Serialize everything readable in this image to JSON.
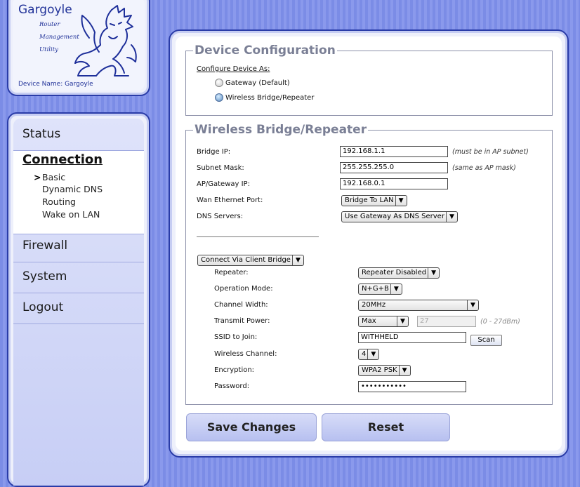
{
  "logo": {
    "title": "Gargoyle",
    "lines": [
      "Router",
      "Management",
      "Utility"
    ],
    "device_name": "Device Name: Gargoyle"
  },
  "nav": {
    "status": "Status",
    "connection": "Connection",
    "sub_arrow": ">",
    "sub_items": [
      "Basic",
      "Dynamic DNS",
      "Routing",
      "Wake on LAN"
    ],
    "firewall": "Firewall",
    "system": "System",
    "logout": "Logout"
  },
  "device_config": {
    "legend": "Device Configuration",
    "configure_label": "Configure Device As:",
    "options": [
      {
        "label": "Gateway (Default)",
        "selected": false
      },
      {
        "label": "Wireless Bridge/Repeater",
        "selected": true
      }
    ]
  },
  "bridge": {
    "legend": "Wireless Bridge/Repeater",
    "bridge_ip": {
      "label": "Bridge IP:",
      "value": "192.168.1.1",
      "note": "(must be in AP subnet)"
    },
    "subnet_mask": {
      "label": "Subnet Mask:",
      "value": "255.255.255.0",
      "note": "(same as AP mask)"
    },
    "gateway_ip": {
      "label": "AP/Gateway IP:",
      "value": "192.168.0.1"
    },
    "wan_port": {
      "label": "Wan Ethernet Port:",
      "value": "Bridge To LAN"
    },
    "dns": {
      "label": "DNS Servers:",
      "value": "Use Gateway As DNS Server"
    },
    "connect_mode": "Connect Via Client Bridge",
    "repeater": {
      "label": "Repeater:",
      "value": "Repeater Disabled"
    },
    "op_mode": {
      "label": "Operation Mode:",
      "value": "N+G+B"
    },
    "channel_width": {
      "label": "Channel Width:",
      "value": "20MHz"
    },
    "tx_power": {
      "label": "Transmit Power:",
      "value": "Max",
      "dbm": "27",
      "note": "(0 - 27dBm)"
    },
    "ssid": {
      "label": "SSID to Join:",
      "value": "WITHHELD",
      "scan": "Scan"
    },
    "channel": {
      "label": "Wireless Channel:",
      "value": "4"
    },
    "encryption": {
      "label": "Encryption:",
      "value": "WPA2 PSK"
    },
    "password": {
      "label": "Password:",
      "value": "•••••••••••"
    }
  },
  "buttons": {
    "save": "Save Changes",
    "reset": "Reset"
  },
  "select_arrow": "▼"
}
